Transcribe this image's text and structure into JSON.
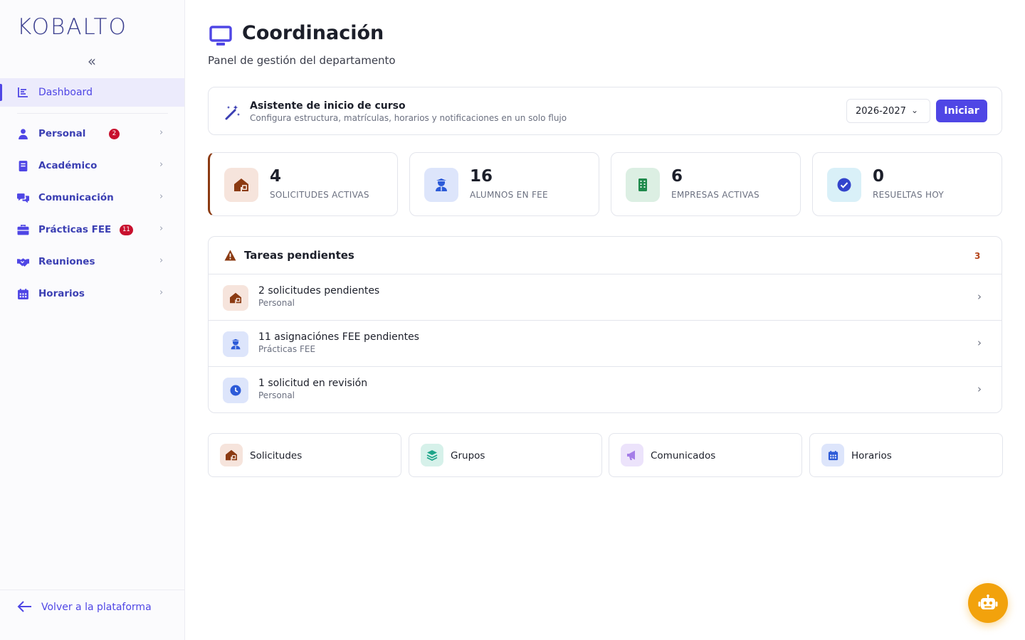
{
  "app": {
    "logo": "KOBALTO",
    "collapse_glyph": "«"
  },
  "sidebar": {
    "dashboard": {
      "label": "Dashboard",
      "icon": "chart-icon"
    },
    "items": [
      {
        "label": "Personal",
        "icon": "user-icon",
        "badge": "2"
      },
      {
        "label": "Académico",
        "icon": "book-icon",
        "badge": ""
      },
      {
        "label": "Comunicación",
        "icon": "chat-icon",
        "badge": ""
      },
      {
        "label": "Prácticas FEE",
        "icon": "briefcase-icon",
        "badge": "11"
      },
      {
        "label": "Reuniones",
        "icon": "handshake-icon",
        "badge": ""
      },
      {
        "label": "Horarios",
        "icon": "calendar-icon",
        "badge": ""
      }
    ],
    "chevron": "›",
    "back": {
      "label": "Volver a la plataforma",
      "icon": "arrow-left-icon"
    }
  },
  "header": {
    "title": "Coordinación",
    "subtitle": "Panel de gestión del departamento",
    "icon": "monitor-icon"
  },
  "wizard": {
    "title": "Asistente de inicio de curso",
    "description": "Configura estructura, matrículas, horarios y notificaciones en un solo flujo",
    "year": "2026-2027",
    "dropdown_glyph": "⌄",
    "start_label": "Iniciar",
    "icon": "magic-wand-icon"
  },
  "stats": [
    {
      "value": "4",
      "label": "SOLICITUDES ACTIVAS",
      "icon": "house-icon"
    },
    {
      "value": "16",
      "label": "ALUMNOS EN FEE",
      "icon": "student-icon"
    },
    {
      "value": "6",
      "label": "EMPRESAS ACTIVAS",
      "icon": "building-icon"
    },
    {
      "value": "0",
      "label": "RESUELTAS HOY",
      "icon": "check-icon"
    }
  ],
  "tasks": {
    "title": "Tareas pendientes",
    "count": "3",
    "items": [
      {
        "title": "2 solicitudes pendientes",
        "sub": "Personal",
        "icon": "house-icon"
      },
      {
        "title": "11 asignaciónes FEE pendientes",
        "sub": "Prácticas FEE",
        "icon": "student-icon"
      },
      {
        "title": "1 solicitud en revisión",
        "sub": "Personal",
        "icon": "clock-icon"
      }
    ]
  },
  "quick": [
    {
      "label": "Solicitudes",
      "icon": "house-icon"
    },
    {
      "label": "Grupos",
      "icon": "layers-icon"
    },
    {
      "label": "Comunicados",
      "icon": "megaphone-icon"
    },
    {
      "label": "Horarios",
      "icon": "calendar-icon"
    }
  ],
  "colors": {
    "primary": "#4f46e5",
    "nav_text": "#3b3fb3",
    "badge": "#c8102e",
    "accent_brown": "#8b3a12",
    "fab": "#f2a20c"
  }
}
